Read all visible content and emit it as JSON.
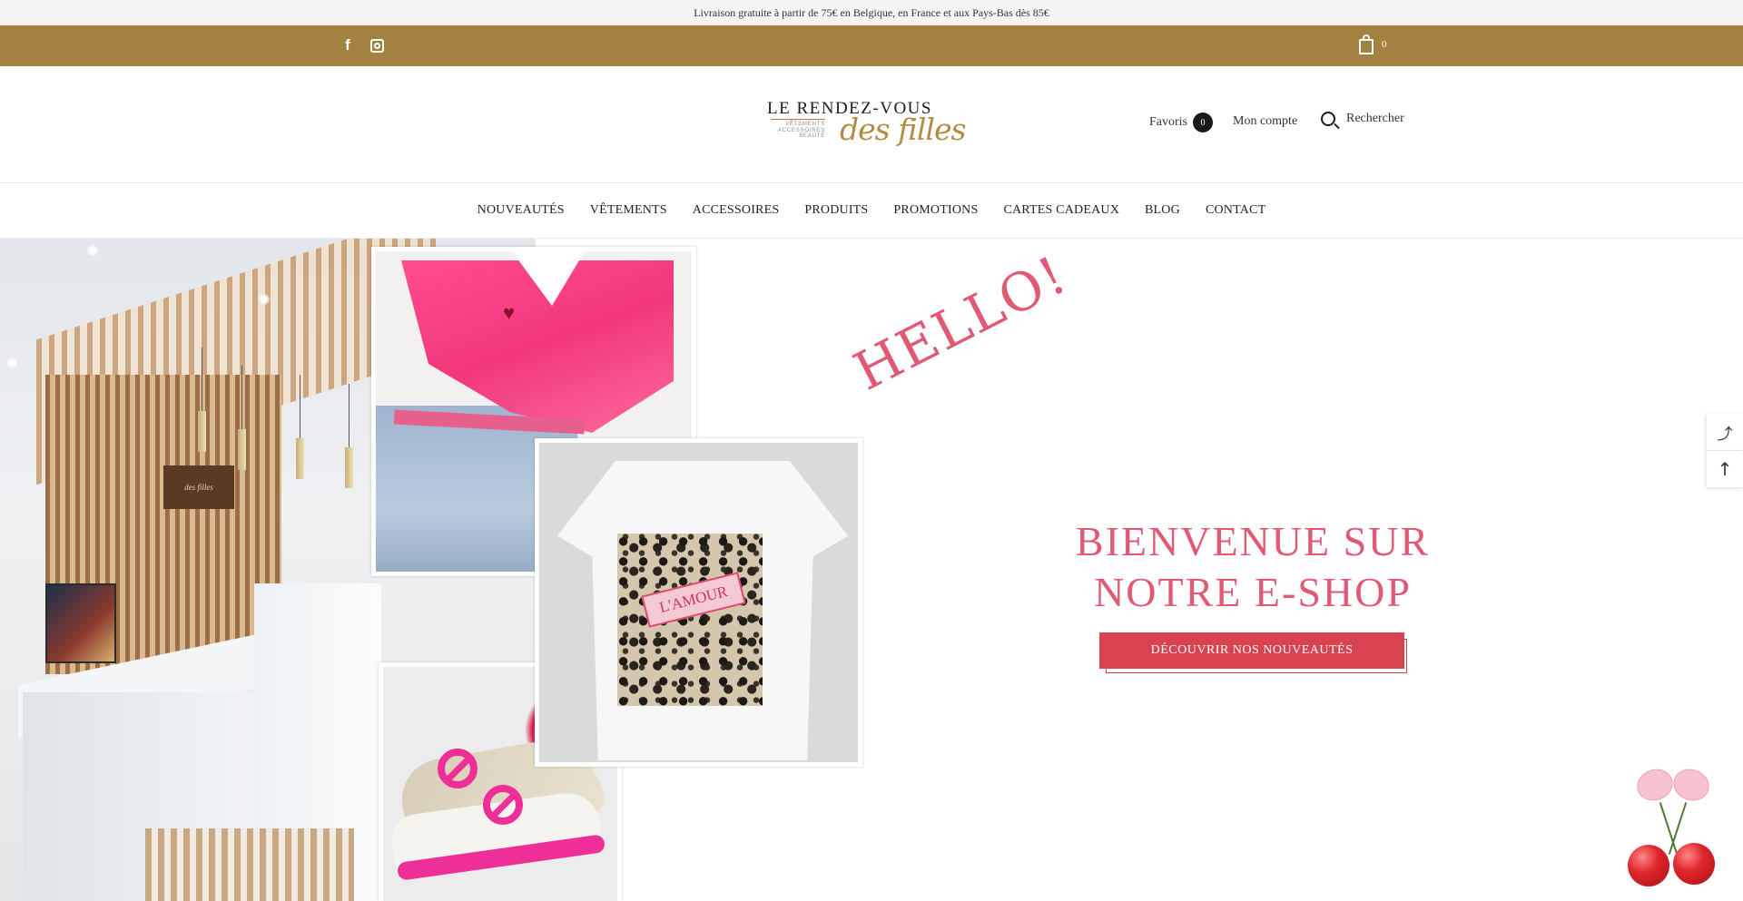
{
  "announcement": "Livraison gratuite à partir de 75€ en Belgique, en France et aux Pays-Bas dès 85€",
  "topbar": {
    "facebook_glyph": "f",
    "cart_count": "0"
  },
  "header": {
    "logo": {
      "line1": "LE RENDEZ-VOUS",
      "sub": "VÊTEMENTS ACCESSOIRES BEAUTÉ",
      "script": "des filles"
    },
    "favorites_label": "Favoris",
    "favorites_count": "0",
    "account_label": "Mon compte",
    "search_label": "Rechercher"
  },
  "nav": {
    "items": [
      {
        "label": "NOUVEAUTÉS"
      },
      {
        "label": "VÊTEMENTS"
      },
      {
        "label": "ACCESSOIRES"
      },
      {
        "label": "PRODUITS"
      },
      {
        "label": "PROMOTIONS"
      },
      {
        "label": "CARTES CADEAUX"
      },
      {
        "label": "BLOG"
      },
      {
        "label": "CONTACT"
      }
    ]
  },
  "hero": {
    "hello": "HELLO!",
    "title_line1": "BIENVENUE SUR",
    "title_line2": "NOTRE E-SHOP",
    "cta_label": "DÉCOUVRIR NOS NOUVEAUTÉS",
    "tee_print": "L'AMOUR",
    "sign_text": "des filles"
  },
  "side": {
    "share_glyph": "⤴",
    "top_glyph": "↑"
  },
  "colors": {
    "gold": "#a38140",
    "accent_pink": "#e05a73",
    "cta_red": "#d9424f"
  },
  "icons": [
    "facebook-icon",
    "instagram-icon",
    "shopping-bag-icon",
    "search-icon",
    "share-icon",
    "arrow-up-icon"
  ]
}
